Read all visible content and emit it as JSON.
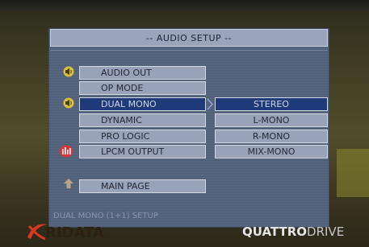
{
  "title": "-- AUDIO SETUP --",
  "menu": [
    {
      "label": "AUDIO OUT",
      "icon": "speaker-icon",
      "active": false
    },
    {
      "label": "OP MODE",
      "icon": "",
      "active": false
    },
    {
      "label": "DUAL MONO",
      "icon": "speaker-icon",
      "active": true
    },
    {
      "label": "DYNAMIC",
      "icon": "",
      "active": false
    },
    {
      "label": "PRO LOGIC",
      "icon": "",
      "active": false
    },
    {
      "label": "LPCM OUTPUT",
      "icon": "equalizer-icon",
      "active": false
    }
  ],
  "main_page": {
    "label": "MAIN PAGE",
    "icon": "up-arrow-icon"
  },
  "options": [
    {
      "label": "STEREO",
      "active": true
    },
    {
      "label": "L-MONO",
      "active": false
    },
    {
      "label": "R-MONO",
      "active": false
    },
    {
      "label": "MIX-MONO",
      "active": false
    }
  ],
  "status_text": "DUAL MONO (1+1) SETUP",
  "brand_left": "RIDATA",
  "brand_right_bold": "QUATTRO",
  "brand_right_light": "DRIVE",
  "colors": {
    "panel": "#52627c",
    "button": "#98a2b8",
    "active": "#1f3a78",
    "icon_yellow": "#d8c23a",
    "icon_red": "#d8353a"
  }
}
